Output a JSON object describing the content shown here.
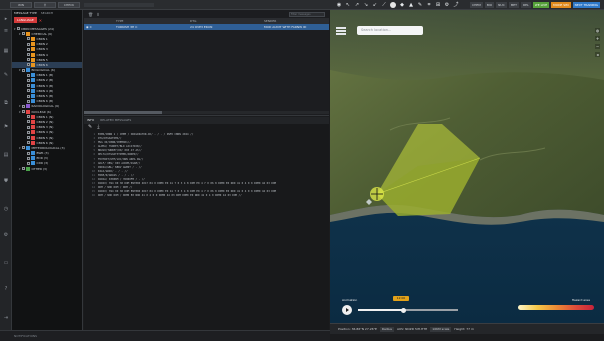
{
  "topbar": {
    "btn_win": "WIN",
    "btn_search": "⚲",
    "btn_check": "CHECK",
    "toggles": [
      "CHEM",
      "BIO",
      "NUC",
      "MET",
      "REL"
    ],
    "live": "LTE LIVE",
    "mode": "MODE SIM",
    "training": "NEXT TRAINING"
  },
  "tree": {
    "tabs": [
      "MESSAGE TYPE",
      "SEARCH"
    ],
    "language_button": "LANGUAGE",
    "root": "CBRN MESSAGES (24)",
    "groups": [
      {
        "label": "CHEMICAL (6)",
        "badge": "orange",
        "items": [
          "CBRN 1",
          "CBRN 2",
          "CBRN 3",
          "CBRN 4",
          "CBRN 5",
          "CBRN 6"
        ]
      },
      {
        "label": "BIOLOGICAL (6)",
        "badge": "blue",
        "items": [
          "CBRN 1 (B)",
          "CBRN 2 (B)",
          "CBRN 3 (B)",
          "CBRN 4 (B)",
          "CBRN 5 (B)",
          "CBRN 6 (B)"
        ]
      },
      {
        "label": "RADIOLOGICAL (6)",
        "badge": "purple",
        "items": []
      },
      {
        "label": "NUCLEAR (6)",
        "badge": "red",
        "items": [
          "CBRN 1 (N)",
          "CBRN 2 (N)",
          "CBRN 3 (N)",
          "CBRN 4 (N)",
          "CBRN 5 (N)",
          "CBRN 6 (N)"
        ]
      },
      {
        "label": "METEOROLOGICAL (3)",
        "badge": "blue",
        "items": [
          "BWR (3)",
          "EDR (3)",
          "CDR (3)"
        ]
      },
      {
        "label": "OTHER (3)",
        "badge": "green",
        "items": []
      }
    ],
    "status": "NOTIFICATIONS"
  },
  "table": {
    "filter_placeholder": "Filter messages",
    "headers": [
      "",
      "TYPE",
      "DTG",
      "SENDER"
    ],
    "row": [
      "C",
      "TURKISH 3H C",
      "24 OVE3 ERUN",
      "MOD AUDIT WITH FARNW ID"
    ]
  },
  "editor": {
    "tabs": [
      "INFO",
      "RELATED MESSAGES"
    ],
    "lines": [
      "EXER/CBRN 1 / CHEM / ORIGINATOR-ID/ - / - / INFO CBRN 2024 //",
      "DTG/DTG0ATOMS//",
      "MSG ID/CBRN/CHEM001//",
      "ALPHA/ TURKEY/BLD LOCATION//",
      "BRAVO/TURKEY/00/ 003 AT AS//",
      "DELTA/DTGOAT3TIMED/ARDED//",
      "FOXTROT/UTM/LOC/OWN AREA RG//",
      "GOLF/ OBS/ 003 ACDPH/ASAM//",
      "INDIA/GBL/ NERV AGENT / - //",
      "KILO/GRID/ - / - //",
      "MIKE/N/GRASS / - / - //",
      "PAPAA/ 0300KM / 35000FM / - //",
      "PAPAX/ 394 00 38 DOM EN7800 4017 84 0 DOM0 E0 41 7 0 3 4 8 DOM E0 4 7 0 06 8 DOM0 E0 NOD 41 0 4 0 0 DOM0 44 03 DOM",
      "  DOM / NOD DOM / DOM // ",
      "PAPAX/ 394 00 38 DOM EN7800 4017 84 0 DOM0 E0 41 7 0 3 4 8 DOM E0 4 7 0 06 8 DOM0 E0 NOD 41 0 4 0 0 DOM0 44 03 DOM",
      "  DOM / NOD DOM / DOM0 E0 NOD 41 0 4 0 0 DOM0 44 03 DOM DOM0 E0 NOD 41 0 4 0 DOM0 44 03 DOM //"
    ]
  },
  "map": {
    "search_placeholder": "Search location...",
    "animation_label": "Animation",
    "time_pill": "12:00",
    "legend_label": "Hazard area",
    "status_position": "Position: 36.86°N 27.26°E",
    "status_radius": "Radius",
    "status_sector": "AOV: NOZD 5IH.HTH",
    "status_scale": "10KM scale",
    "status_height": "Height: 77 m",
    "playback_fraction": 0.45,
    "colors": {
      "hazard_fill": "#c6d83a",
      "hazard_dark": "#8ea12a",
      "sea": "#0f3650",
      "land": "#5b6b3a"
    }
  }
}
